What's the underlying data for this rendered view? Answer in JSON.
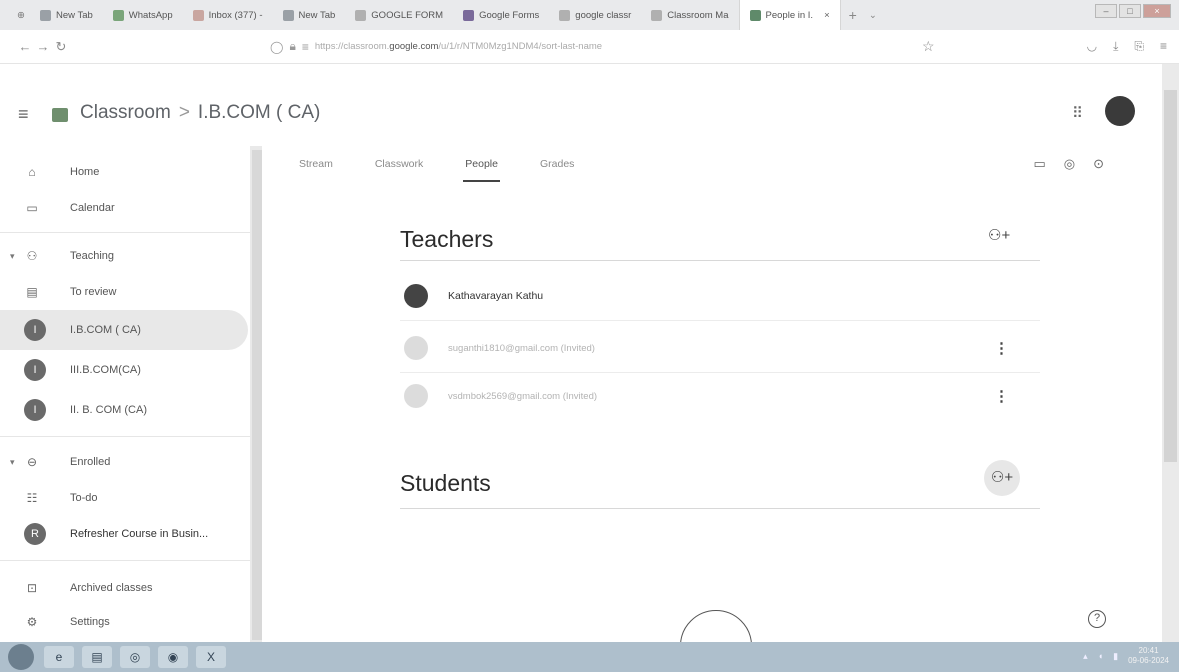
{
  "browser": {
    "tabs": [
      {
        "label": "New Tab",
        "active": false
      },
      {
        "label": "WhatsApp",
        "active": false
      },
      {
        "label": "Inbox (377) - ",
        "active": false
      },
      {
        "label": "New Tab",
        "active": false
      },
      {
        "label": "GOOGLE FORM",
        "active": false
      },
      {
        "label": "Google Forms",
        "active": false
      },
      {
        "label": "google classr",
        "active": false
      },
      {
        "label": "Classroom Ma",
        "active": false
      },
      {
        "label": "People in I.",
        "active": true
      }
    ],
    "new_tab": "+",
    "tab_dropdown": "⌄",
    "url_prefix": "https://classroom.",
    "url_domain": "google.com",
    "url_suffix": "/u/1/r/NTM0Mzg1NDM4/sort-last-name"
  },
  "header": {
    "app_name": "Classroom",
    "separator": ">",
    "class_name": "I.B.COM ( CA)"
  },
  "sidebar": {
    "items": [
      {
        "label": "Home",
        "icon": "home-icon"
      },
      {
        "label": "Calendar",
        "icon": "calendar-icon"
      },
      {
        "label": "Teaching",
        "icon": "teaching-icon"
      },
      {
        "label": "To review",
        "icon": "to-review-icon"
      },
      {
        "label": "I.B.COM ( CA)",
        "avatar": "I"
      },
      {
        "label": "III.B.COM(CA)",
        "avatar": "I"
      },
      {
        "label": "II. B. COM (CA)",
        "avatar": "I"
      },
      {
        "label": "Enrolled",
        "icon": "enrolled-icon"
      },
      {
        "label": "To-do",
        "icon": "todo-icon"
      },
      {
        "label": "Refresher Course in Busin...",
        "avatar": "R"
      },
      {
        "label": "Archived classes",
        "icon": "archive-icon"
      },
      {
        "label": "Settings",
        "icon": "settings-icon"
      }
    ]
  },
  "main": {
    "tabs": [
      {
        "label": "Stream"
      },
      {
        "label": "Classwork"
      },
      {
        "label": "People"
      },
      {
        "label": "Grades"
      }
    ],
    "teachers_title": "Teachers",
    "students_title": "Students",
    "teachers": [
      {
        "name": "Kathavarayan Kathu",
        "invited": false
      },
      {
        "name": "suganthi1810@gmail.com (Invited)",
        "invited": true
      },
      {
        "name": "vsdmbok2569@gmail.com (Invited)",
        "invited": true
      }
    ],
    "help": "?"
  },
  "taskbar": {
    "clock_time": "20:41",
    "clock_date": "09-06-2024"
  }
}
